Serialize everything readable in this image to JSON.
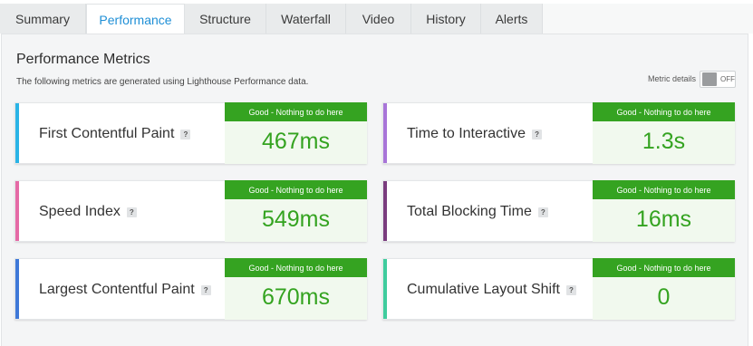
{
  "tabs": [
    {
      "label": "Summary",
      "active": false
    },
    {
      "label": "Performance",
      "active": true
    },
    {
      "label": "Structure",
      "active": false
    },
    {
      "label": "Waterfall",
      "active": false
    },
    {
      "label": "Video",
      "active": false
    },
    {
      "label": "History",
      "active": false
    },
    {
      "label": "Alerts",
      "active": false
    }
  ],
  "panel": {
    "title": "Performance Metrics",
    "description": "The following metrics are generated using Lighthouse Performance data.",
    "toggle_label": "Metric details",
    "toggle_state": "OFF"
  },
  "metrics": [
    {
      "name": "First Contentful Paint",
      "grade": "Good - Nothing to do here",
      "value": "467ms",
      "accent": "#2ab4e6"
    },
    {
      "name": "Time to Interactive",
      "grade": "Good - Nothing to do here",
      "value": "1.3s",
      "accent": "#a875d8"
    },
    {
      "name": "Speed Index",
      "grade": "Good - Nothing to do here",
      "value": "549ms",
      "accent": "#e56aa6"
    },
    {
      "name": "Total Blocking Time",
      "grade": "Good - Nothing to do here",
      "value": "16ms",
      "accent": "#7a3c7e"
    },
    {
      "name": "Largest Contentful Paint",
      "grade": "Good - Nothing to do here",
      "value": "670ms",
      "accent": "#3f79d8"
    },
    {
      "name": "Cumulative Layout Shift",
      "grade": "Good - Nothing to do here",
      "value": "0",
      "accent": "#3fcc9e"
    }
  ],
  "help_glyph": "?",
  "colors": {
    "active_tab": "#1f8fd6",
    "grade_good": "#35a321",
    "grade_value": "#34a320"
  }
}
